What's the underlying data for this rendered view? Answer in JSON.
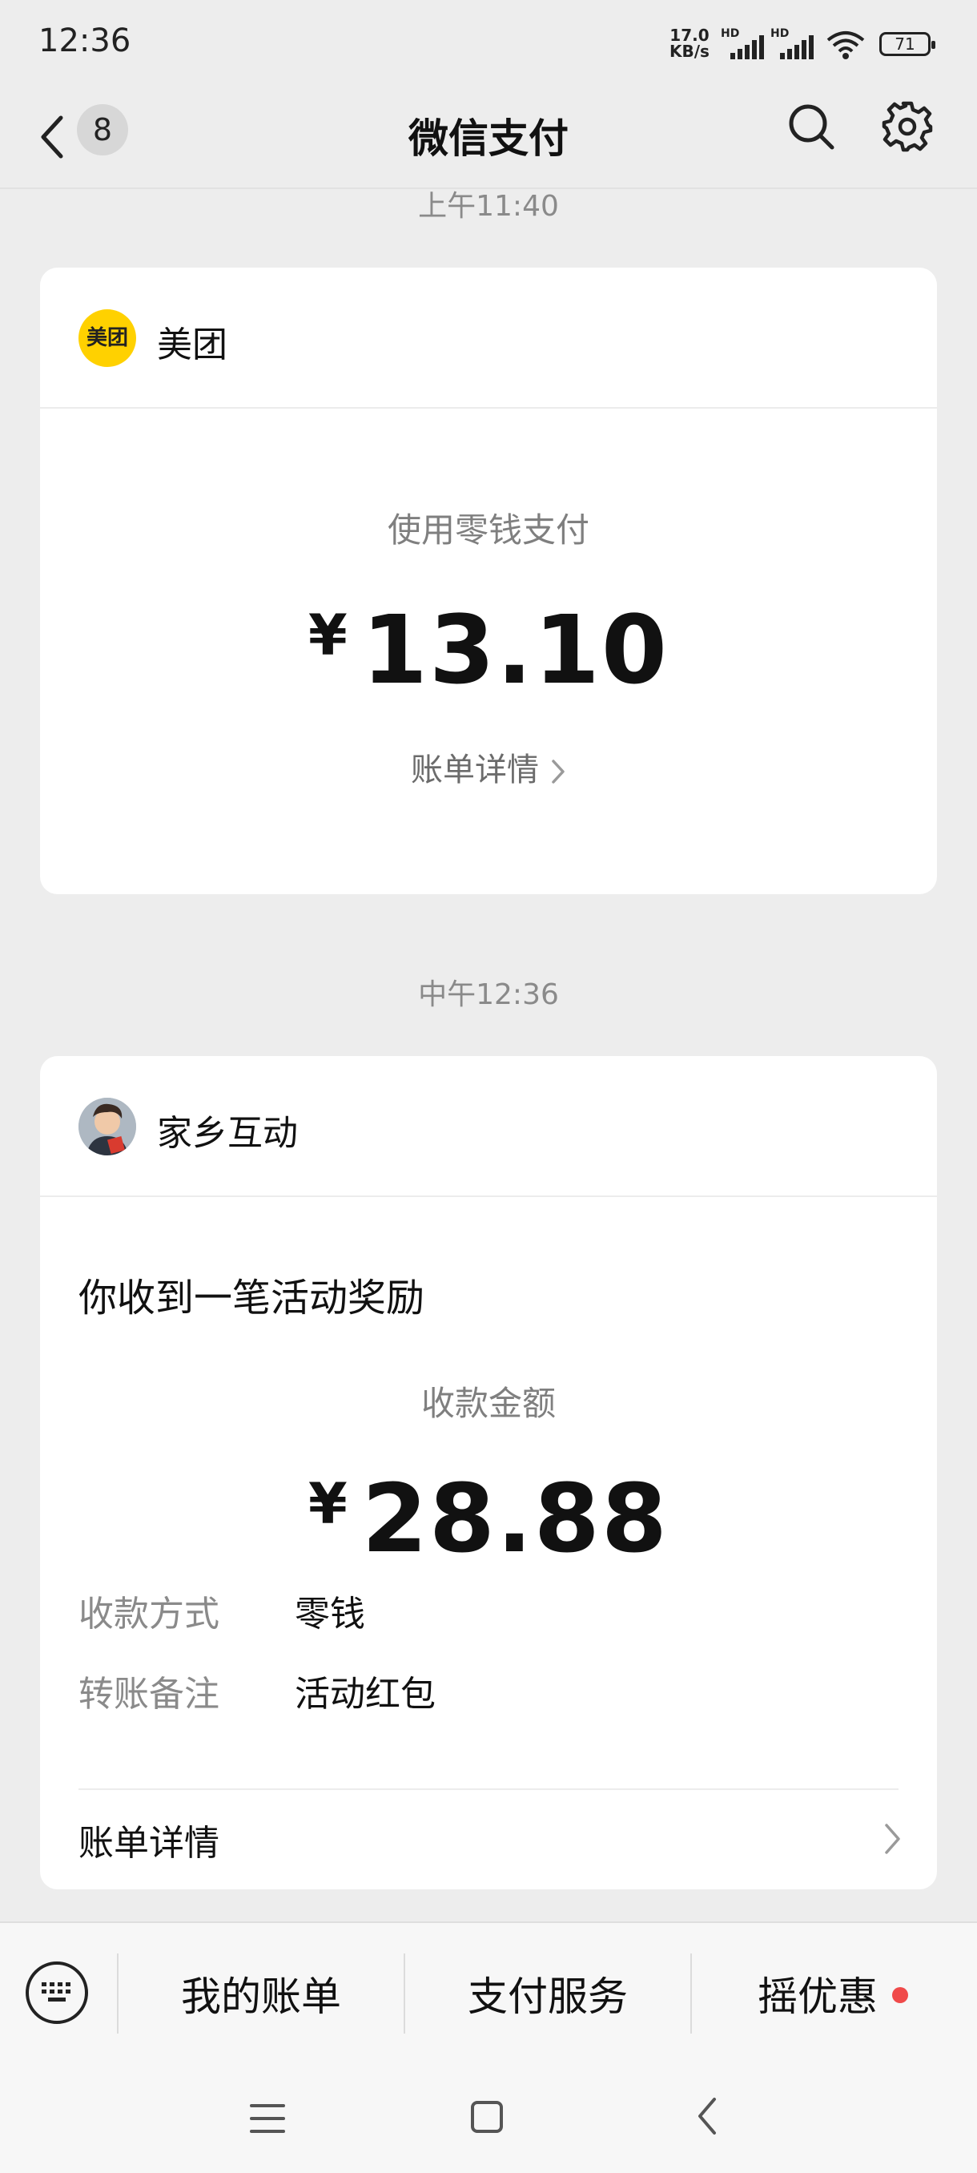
{
  "status_bar": {
    "time": "12:36",
    "network_speed_value": "17.0",
    "network_speed_unit": "KB/s",
    "sim1_label": "HD",
    "sim2_label": "HD",
    "battery": "71"
  },
  "header": {
    "unread_count": "8",
    "title": "微信支付"
  },
  "messages": [
    {
      "timestamp": "上午11:40",
      "merchant": "美团",
      "merchant_logo_text": "美团",
      "label": "使用零钱支付",
      "currency": "¥",
      "amount": "13.10",
      "detail_link": "账单详情"
    },
    {
      "timestamp": "中午12:36",
      "merchant": "家乡互动",
      "title": "你收到一笔活动奖励",
      "label": "收款金额",
      "currency": "¥",
      "amount": "28.88",
      "rows": [
        {
          "label": "收款方式",
          "value": "零钱"
        },
        {
          "label": "转账备注",
          "value": "活动红包"
        }
      ],
      "detail_link": "账单详情"
    }
  ],
  "toolbar": {
    "items": [
      "我的账单",
      "支付服务",
      "摇优惠"
    ]
  },
  "colors": {
    "background": "#ededed",
    "card": "#ffffff",
    "meituan_yellow": "#ffd100",
    "notification_red": "#f04a4a"
  }
}
